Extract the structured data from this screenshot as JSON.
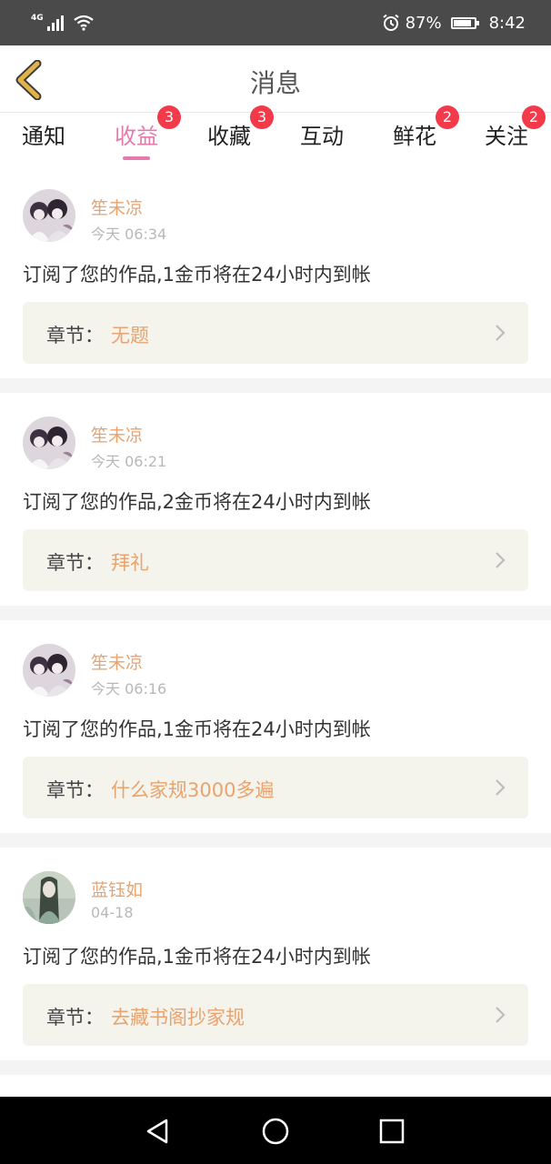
{
  "status_bar": {
    "network": "4G",
    "battery": "87%",
    "battery_level": 0.87,
    "time": "8:42"
  },
  "header": {
    "title": "消息"
  },
  "tabs": [
    {
      "label": "通知",
      "badge": ""
    },
    {
      "label": "收益",
      "badge": "3",
      "active": true
    },
    {
      "label": "收藏",
      "badge": "3"
    },
    {
      "label": "互动",
      "badge": ""
    },
    {
      "label": "鲜花",
      "badge": "2"
    },
    {
      "label": "关注",
      "badge": "2"
    }
  ],
  "feed": [
    {
      "name": "笙未凉",
      "time": "今天 06:34",
      "message": "订阅了您的作品,1金币将在24小时内到帐",
      "chapter_label": "章节：",
      "chapter": "无题"
    },
    {
      "name": "笙未凉",
      "time": "今天 06:21",
      "message": "订阅了您的作品,2金币将在24小时内到帐",
      "chapter_label": "章节：",
      "chapter": "拜礼"
    },
    {
      "name": "笙未凉",
      "time": "今天 06:16",
      "message": "订阅了您的作品,1金币将在24小时内到帐",
      "chapter_label": "章节：",
      "chapter": "什么家规3000多遍"
    },
    {
      "name": "蓝钰如",
      "time": "04-18",
      "message": "订阅了您的作品,1金币将在24小时内到帐",
      "chapter_label": "章节：",
      "chapter": "去藏书阁抄家规"
    }
  ],
  "colors": {
    "accent_pink": "#e57bab",
    "accent_orange": "#e8a36e",
    "badge_red": "#f33a4a",
    "back_arrow": "#e2b34a"
  },
  "icons": {
    "back": "chevron-left-icon",
    "nav_back": "triangle-back-icon",
    "nav_home": "circle-home-icon",
    "nav_recents": "square-recents-icon"
  }
}
